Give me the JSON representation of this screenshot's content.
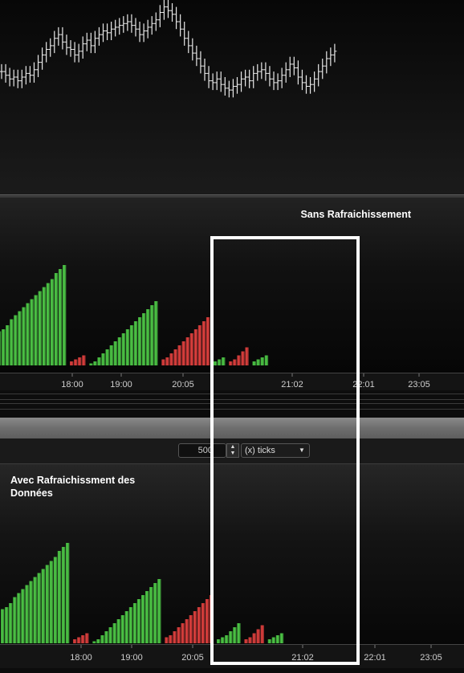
{
  "colors": {
    "up": "#4ecc47",
    "down": "#e2403e",
    "price": "#e8e8e8",
    "axis_text": "#cfcfcf",
    "highlight": "#ffffff"
  },
  "top_chart": {
    "title": "Sans Rafraichissement"
  },
  "bottom_chart": {
    "title": "Avec Rafraichissment des Données"
  },
  "toolbar": {
    "period_value": "500",
    "unit_label": "(x) ticks"
  },
  "chart_data": [
    {
      "type": "ohlc",
      "series": [
        {
          "values": [
            43,
            41,
            39,
            40,
            38,
            40,
            42,
            41,
            44,
            48,
            52,
            55,
            57,
            61,
            63,
            59,
            56,
            55,
            52,
            54,
            58,
            60,
            57,
            61,
            63,
            65,
            64,
            66,
            67,
            68,
            69,
            70,
            68,
            66,
            63,
            65,
            67,
            69,
            71,
            75,
            78,
            76,
            74,
            70,
            66,
            61,
            57,
            53,
            50,
            46,
            42,
            38,
            37,
            39,
            36,
            34,
            33,
            35,
            36,
            39,
            40,
            38,
            42,
            43,
            44,
            42,
            39,
            37,
            38,
            41,
            44,
            47,
            45,
            40,
            37,
            35,
            36,
            39,
            43,
            46,
            50,
            52,
            54
          ]
        }
      ]
    },
    {
      "type": "bar",
      "title": "Sans Rafraichissement",
      "x_ticks": [
        "18:00",
        "19:00",
        "20:05",
        "21:02",
        "22:01",
        "23:05"
      ],
      "series": [
        {
          "color_role": "up",
          "segment": 1,
          "values": [
            17,
            18,
            20,
            23,
            25,
            27,
            29,
            31,
            33,
            35,
            37,
            39,
            41,
            43,
            46,
            48,
            50
          ]
        },
        {
          "color_role": "down",
          "segment": 2,
          "values": [
            2,
            3,
            4,
            5
          ]
        },
        {
          "color_role": "up",
          "segment": 3,
          "values": [
            1,
            2,
            4,
            6,
            8,
            10,
            12,
            14,
            16,
            18,
            20,
            22,
            24,
            26,
            28,
            30,
            32
          ]
        },
        {
          "color_role": "down",
          "segment": 4,
          "values": [
            3,
            4,
            6,
            8,
            10,
            12,
            14,
            16,
            18,
            20,
            22,
            24
          ]
        },
        {
          "color_role": "up",
          "segment": 5,
          "values": [
            2,
            3,
            4
          ]
        },
        {
          "color_role": "down",
          "segment": 6,
          "values": [
            2,
            3,
            5,
            7,
            9
          ]
        },
        {
          "color_role": "up",
          "segment": 7,
          "values": [
            2,
            3,
            4,
            5
          ]
        }
      ]
    },
    {
      "type": "bar",
      "title": "Avec Rafraichissment des Données",
      "x_ticks": [
        "18:00",
        "19:00",
        "20:05",
        "21:02",
        "22:01",
        "23:05"
      ],
      "series": [
        {
          "color_role": "up",
          "segment": 1,
          "values": [
            17,
            18,
            20,
            23,
            25,
            27,
            29,
            31,
            33,
            35,
            37,
            39,
            41,
            43,
            46,
            48,
            50
          ]
        },
        {
          "color_role": "down",
          "segment": 2,
          "values": [
            2,
            3,
            4,
            5
          ]
        },
        {
          "color_role": "up",
          "segment": 3,
          "values": [
            1,
            2,
            4,
            6,
            8,
            10,
            12,
            14,
            16,
            18,
            20,
            22,
            24,
            26,
            28,
            30,
            32
          ]
        },
        {
          "color_role": "down",
          "segment": 4,
          "values": [
            3,
            4,
            6,
            8,
            10,
            12,
            14,
            16,
            18,
            20,
            22,
            24
          ]
        },
        {
          "color_role": "up",
          "segment": 5,
          "values": [
            2,
            3,
            4,
            6,
            8,
            10
          ]
        },
        {
          "color_role": "down",
          "segment": 6,
          "values": [
            2,
            3,
            5,
            7,
            9
          ]
        },
        {
          "color_role": "up",
          "segment": 7,
          "values": [
            2,
            3,
            4,
            5
          ]
        }
      ]
    }
  ]
}
